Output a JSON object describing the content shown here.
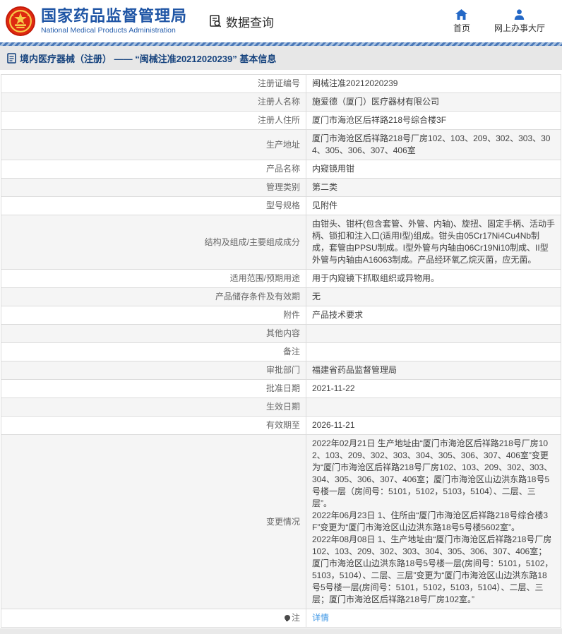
{
  "header": {
    "org_name_cn": "国家药品监督管理局",
    "org_name_en": "National Medical Products Administration",
    "data_query_label": "数据查询",
    "nav": {
      "home": "首页",
      "online_hall": "网上办事大厅"
    }
  },
  "breadcrumb": {
    "text": "境内医疗器械（注册） —— “闽械注准20212020239” 基本信息"
  },
  "table": {
    "rows": [
      {
        "label": "注册证编号",
        "value": "闽械注准20212020239"
      },
      {
        "label": "注册人名称",
        "value": "施爱德（厦门）医疗器材有限公司"
      },
      {
        "label": "注册人住所",
        "value": "厦门市海沧区后祥路218号综合楼3F"
      },
      {
        "label": "生产地址",
        "value": "厦门市海沧区后祥路218号厂房102、103、209、302、303、304、305、306、307、406室"
      },
      {
        "label": "产品名称",
        "value": "内窥镜用钳"
      },
      {
        "label": "管理类别",
        "value": "第二类"
      },
      {
        "label": "型号规格",
        "value": "见附件"
      },
      {
        "label": "结构及组成/主要组成成分",
        "value": "由钳头、钳杆(包含套管、外管、内轴)、旋扭、固定手柄、活动手柄、锁扣和注入口(适用I型)组成。钳头由05Cr17Ni4Cu4Nb制成，套管由PPSU制成。I型外管与内轴由06Cr19Ni10制成、II型外管与内轴由A16063制成。产品经环氧乙烷灭菌，应无菌。"
      },
      {
        "label": "适用范围/预期用途",
        "value": "用于内窥镜下抓取组织或异物用。"
      },
      {
        "label": "产品储存条件及有效期",
        "value": "无"
      },
      {
        "label": "附件",
        "value": "产品技术要求"
      },
      {
        "label": "其他内容",
        "value": ""
      },
      {
        "label": "备注",
        "value": ""
      },
      {
        "label": "审批部门",
        "value": "福建省药品监督管理局"
      },
      {
        "label": "批准日期",
        "value": "2021-11-22"
      },
      {
        "label": "生效日期",
        "value": ""
      },
      {
        "label": "有效期至",
        "value": "2026-11-21"
      },
      {
        "label": "变更情况",
        "value": [
          "2022年02月21日 生产地址由“厦门市海沧区后祥路218号厂房102、103、209、302、303、304、305、306、307、406室”变更为“厦门市海沧区后祥路218号厂房102、103、209、302、303、304、305、306、307、406室；厦门市海沧区山边洪东路18号5号楼一层（房间号：5101，5102，5103，5104）、二层、三层”。",
          "2022年06月23日 1、住所由“厦门市海沧区后祥路218号综合楼3F”变更为“厦门市海沧区山边洪东路18号5号楼5602室”。",
          "2022年08月08日 1、生产地址由“厦门市海沧区后祥路218号厂房102、103、209、302、303、304、305、306、307、406室；厦门市海沧区山边洪东路18号5号楼一层(房间号：5101，5102，5103，5104）、二层、三层”变更为“厦门市海沧区山边洪东路18号5号楼一层(房间号：5101，5102，5103，5104）、二层、三层；厦门市海沧区后祥路218号厂房102室。”"
        ]
      },
      {
        "label": "注",
        "label_icon": "note-pin-icon",
        "value": "详情",
        "link": true
      }
    ]
  },
  "colors": {
    "brand_blue": "#1f55a5",
    "nav_icon_blue": "#2468c6",
    "breadcrumb_text_blue": "#16437e",
    "link_blue": "#3e97e6",
    "alt_row_bg": "#f5f5f5",
    "emblem_red": "#de2910",
    "emblem_gold": "#f7c948"
  }
}
